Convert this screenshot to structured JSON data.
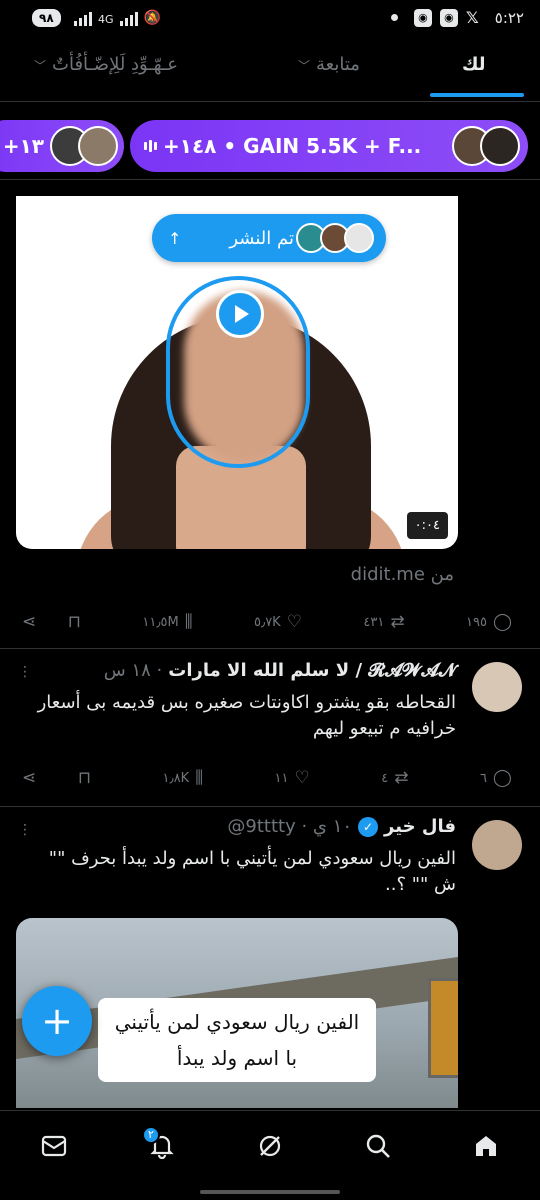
{
  "status_bar": {
    "battery": "٩٨",
    "network": "4G",
    "time": "٥:٢٢"
  },
  "tabs": {
    "for_you": "لك",
    "following": "متابعة",
    "third": "عـهّـوِّدِ لَلِإضّـأفُأتٌ"
  },
  "spaces": {
    "main_title": "+١٤٨ • GAIN 5.5K + F...",
    "left_title": "+١٣"
  },
  "post1": {
    "posted_label": "تم النشر",
    "duration": "٠:٠٤",
    "source": "من didit.me",
    "actions": {
      "replies": "١٩٥",
      "reposts": "٤٣١",
      "likes": "٥٫٧K",
      "views": "١١٫٥M"
    }
  },
  "post2": {
    "name": "لا سلم الله الا مارات / 𝓡𝓐𝓦𝓐𝓝",
    "handle": "١٨ س ·",
    "text": "القحاطه بقو يشترو اكاونتات صغيره بس قديمه بى أسعار خرافيه م تبيعو ليهم",
    "actions": {
      "replies": "٦",
      "reposts": "٤",
      "likes": "١١",
      "views": "١٫٨K"
    }
  },
  "post3": {
    "name": "فال خير",
    "handle": "@9tttty · ١٠ ي",
    "text": "الفين ريال سعودي لمن يأتيني با اسم ولد يبدأ   بحرف \"\" ش \"\" ؟..",
    "caption_line1": "الفين ريال سعودي لمن يأتيني",
    "caption_line2": "با اسم ولد يبدأ"
  },
  "bottom_nav": {
    "notifications_badge": "٢"
  },
  "colors": {
    "accent": "#1d9bf0",
    "spaces_purple": "#7b35f5",
    "background": "#000000"
  }
}
